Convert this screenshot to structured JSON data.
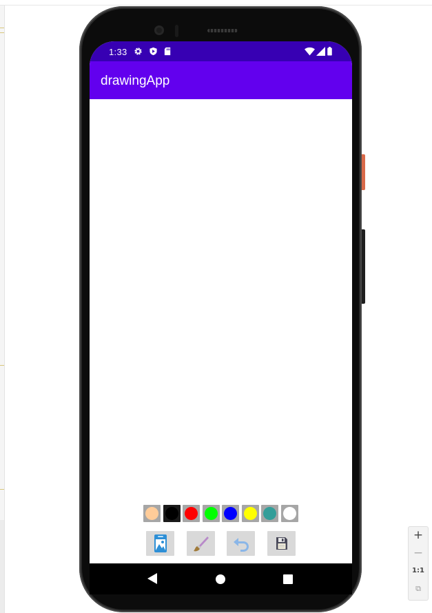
{
  "status_bar": {
    "time": "1:33",
    "left_icons": [
      "gear-icon",
      "shield-icon",
      "sd-card-icon"
    ],
    "right_icons": [
      "wifi-icon",
      "signal-icon",
      "battery-icon"
    ]
  },
  "app_bar": {
    "title": "drawingApp",
    "color": "#6200ee",
    "status_color": "#3700b3"
  },
  "palette": {
    "colors": [
      "#ffcc99",
      "#000000",
      "#ff0000",
      "#00ff00",
      "#0000ff",
      "#ffff00",
      "#339e99",
      "#ffffff"
    ],
    "selected_index": 1
  },
  "toolbar": {
    "tools": [
      "gallery-icon",
      "brush-icon",
      "undo-icon",
      "save-icon"
    ]
  },
  "nav_bar": {
    "buttons": [
      "back-icon",
      "home-icon",
      "recents-icon"
    ]
  },
  "zoom_controls": {
    "zoom_in": "+",
    "zoom_out": "−",
    "actual_size": "1:1",
    "fit": "⧉"
  }
}
